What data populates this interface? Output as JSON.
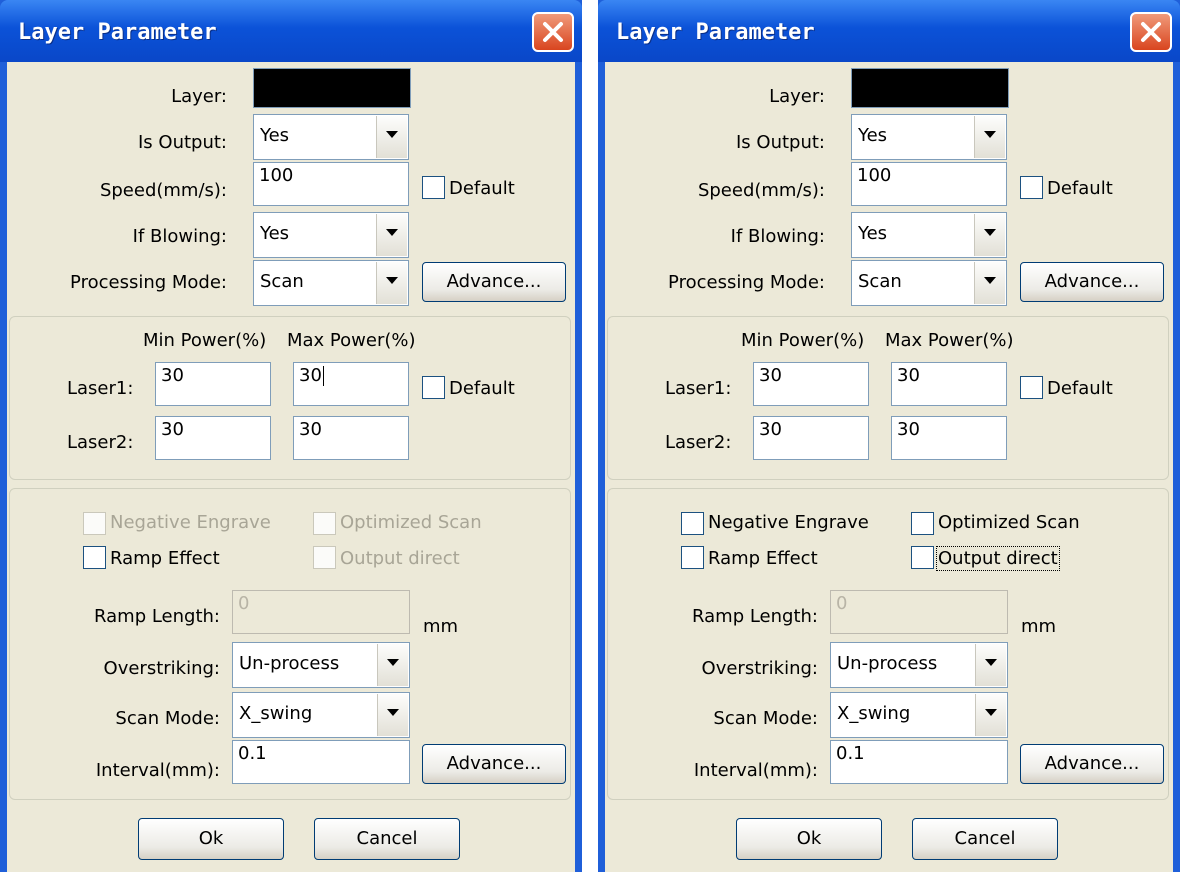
{
  "dialogs": [
    {
      "title": "Layer Parameter",
      "layer_label": "Layer:",
      "is_output_label": "Is Output:",
      "is_output_value": "Yes",
      "speed_label": "Speed(mm/s):",
      "speed_value": "100",
      "speed_default_label": "Default",
      "if_blowing_label": "If Blowing:",
      "if_blowing_value": "Yes",
      "processing_mode_label": "Processing Mode:",
      "processing_mode_value": "Scan",
      "advance_label": "Advance...",
      "min_power_header": "Min Power(%)",
      "max_power_header": "Max Power(%)",
      "laser1_label": "Laser1:",
      "laser1_min": "30",
      "laser1_max": "30",
      "power_default_label": "Default",
      "laser2_label": "Laser2:",
      "laser2_min": "30",
      "laser2_max": "30",
      "negative_engrave_label": "Negative Engrave",
      "optimized_scan_label": "Optimized Scan",
      "ramp_effect_label": "Ramp Effect",
      "output_direct_label": "Output direct",
      "ramp_length_label": "Ramp Length:",
      "ramp_length_value": "0",
      "ramp_length_unit": "mm",
      "overstriking_label": "Overstriking:",
      "overstriking_value": "Un-process",
      "scan_mode_label": "Scan Mode:",
      "scan_mode_value": "X_swing",
      "interval_label": "Interval(mm):",
      "interval_value": "0.1",
      "interval_advance_label": "Advance...",
      "ok_label": "Ok",
      "cancel_label": "Cancel"
    },
    {
      "title": "Layer Parameter",
      "layer_label": "Layer:",
      "is_output_label": "Is Output:",
      "is_output_value": "Yes",
      "speed_label": "Speed(mm/s):",
      "speed_value": "100",
      "speed_default_label": "Default",
      "if_blowing_label": "If Blowing:",
      "if_blowing_value": "Yes",
      "processing_mode_label": "Processing Mode:",
      "processing_mode_value": "Scan",
      "advance_label": "Advance...",
      "min_power_header": "Min Power(%)",
      "max_power_header": "Max Power(%)",
      "laser1_label": "Laser1:",
      "laser1_min": "30",
      "laser1_max": "30",
      "power_default_label": "Default",
      "laser2_label": "Laser2:",
      "laser2_min": "30",
      "laser2_max": "30",
      "negative_engrave_label": "Negative Engrave",
      "optimized_scan_label": "Optimized Scan",
      "ramp_effect_label": "Ramp Effect",
      "output_direct_label": "Output direct",
      "ramp_length_label": "Ramp Length:",
      "ramp_length_value": "0",
      "ramp_length_unit": "mm",
      "overstriking_label": "Overstriking:",
      "overstriking_value": "Un-process",
      "scan_mode_label": "Scan Mode:",
      "scan_mode_value": "X_swing",
      "interval_label": "Interval(mm):",
      "interval_value": "0.1",
      "interval_advance_label": "Advance...",
      "ok_label": "Ok",
      "cancel_label": "Cancel"
    }
  ],
  "colors": {
    "titlebar": "#0b52d8",
    "dialog_bg": "#ece9d8",
    "layer_color": "#000000",
    "close_button": "#d9451f"
  },
  "icons": {
    "close": "close-x-icon",
    "dropdown": "chevron-down-icon"
  }
}
